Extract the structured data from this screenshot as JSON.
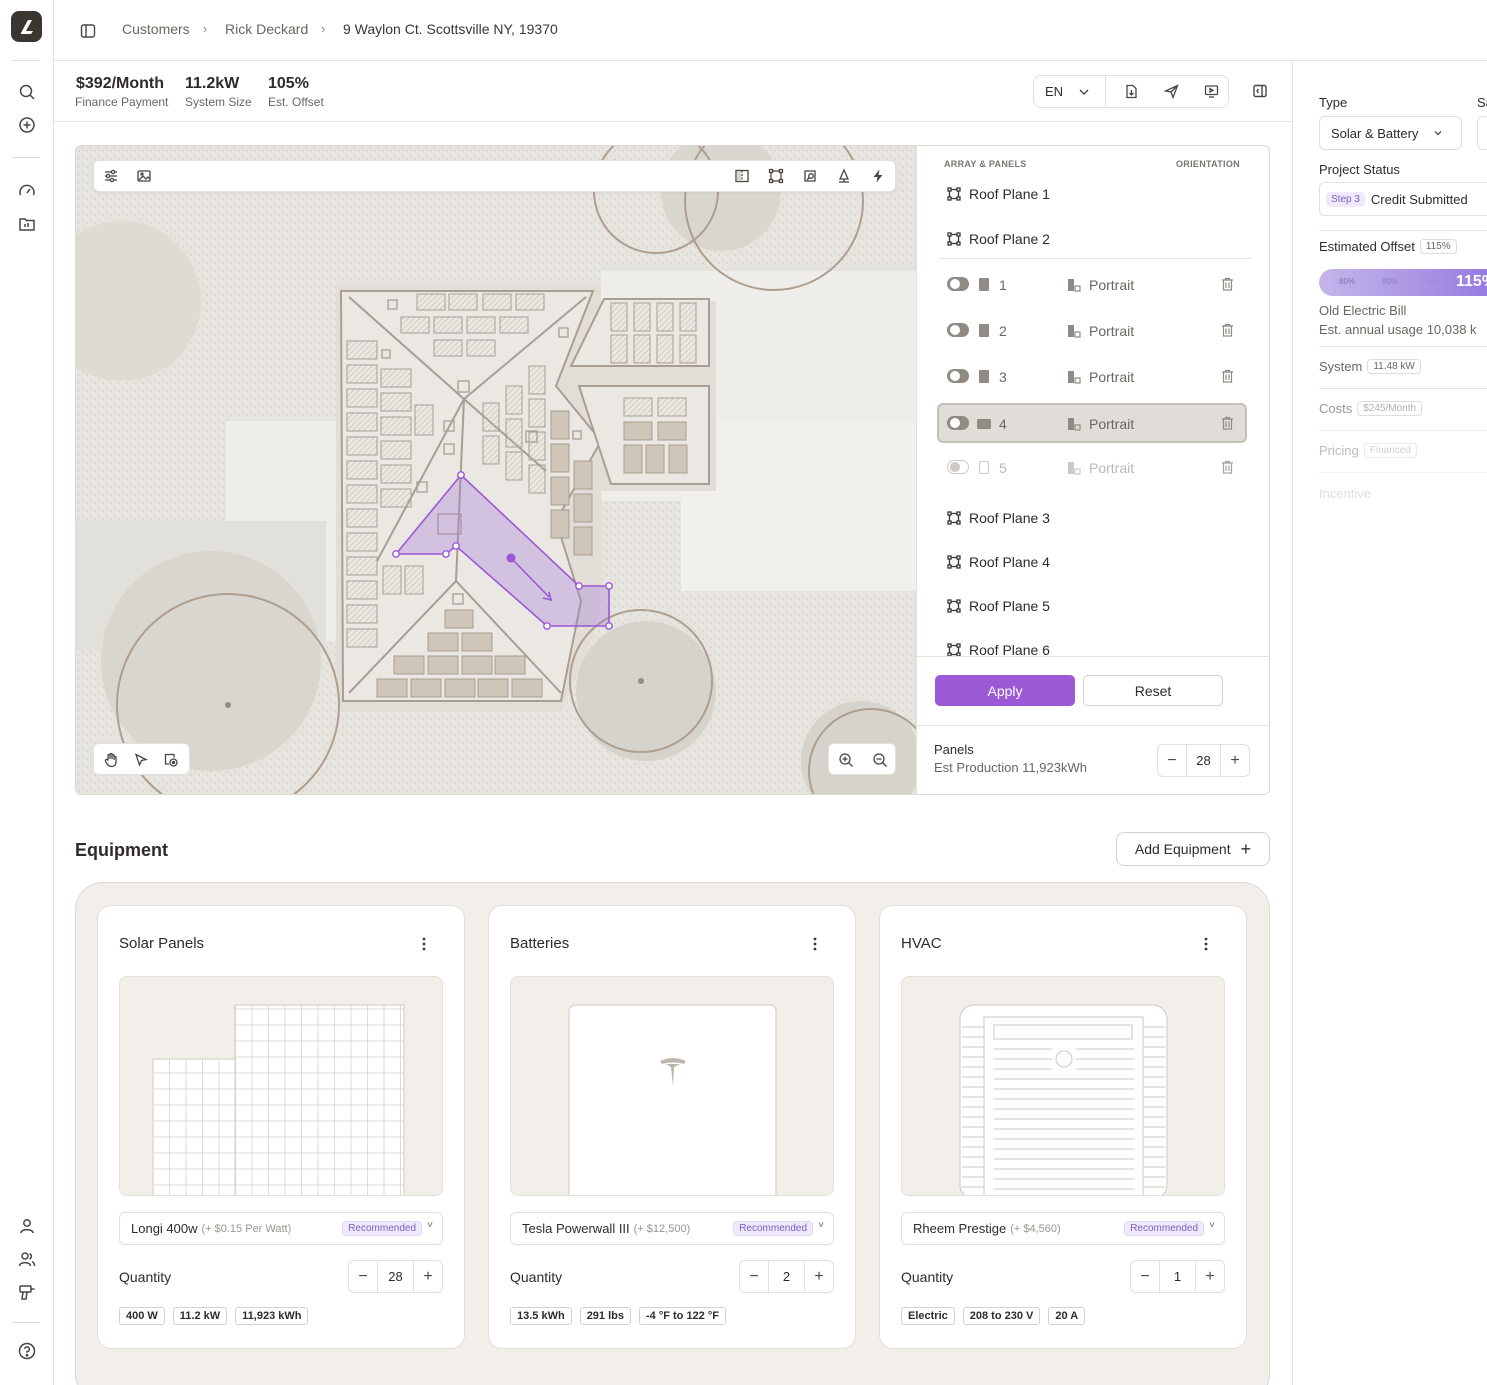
{
  "breadcrumbs": [
    "Customers",
    "Rick Deckard",
    "9 Waylon Ct. Scottsville NY, 19370"
  ],
  "summary": [
    {
      "value": "$392/Month",
      "label": "Finance Payment"
    },
    {
      "value": "11.2kW",
      "label": "System Size"
    },
    {
      "value": "105%",
      "label": "Est. Offset"
    }
  ],
  "language": "EN",
  "panel": {
    "header_left": "ARRAY & PANELS",
    "header_right": "ORIENTATION",
    "planes_top": [
      "Roof Plane 1",
      "Roof Plane 2"
    ],
    "arrays": [
      {
        "num": "1",
        "orientation": "Portrait"
      },
      {
        "num": "2",
        "orientation": "Portrait"
      },
      {
        "num": "3",
        "orientation": "Portrait"
      },
      {
        "num": "4",
        "orientation": "Portrait"
      },
      {
        "num": "5",
        "orientation": "Portrait"
      }
    ],
    "planes_bottom": [
      "Roof Plane 3",
      "Roof Plane 4",
      "Roof Plane 5",
      "Roof Plane 6"
    ],
    "apply": "Apply",
    "reset": "Reset",
    "panels_label": "Panels",
    "est_production": "Est Production 11,923kWh",
    "panel_count": "28"
  },
  "equipment": {
    "title": "Equipment",
    "add_button": "Add Equipment",
    "cards": [
      {
        "title": "Solar Panels",
        "product": "Longi 400w",
        "price": "(+ $0.15 Per Watt)",
        "badge": "Recommended",
        "qty_label": "Quantity",
        "qty": "28",
        "chips": [
          "400 W",
          "11.2 kW",
          "11,923 kWh"
        ]
      },
      {
        "title": "Batteries",
        "product": "Tesla Powerwall III",
        "price": "(+ $12,500)",
        "badge": "Recommended",
        "qty_label": "Quantity",
        "qty": "2",
        "chips": [
          "13.5 kWh",
          "291 lbs",
          "-4 °F to 122 °F"
        ]
      },
      {
        "title": "HVAC",
        "product": "Rheem Prestige",
        "price": "(+ $4,560)",
        "badge": "Recommended",
        "qty_label": "Quantity",
        "qty": "1",
        "chips": [
          "Electric",
          "208 to 230 V",
          "20 A"
        ]
      }
    ]
  },
  "sidebar": {
    "type_label": "Type",
    "second_label": "Sa",
    "type_value": "Solar & Battery",
    "status_label": "Project Status",
    "step": "Step 3",
    "status_value": "Credit Submitted",
    "offset_label": "Estimated Offset",
    "offset_pill": "115%",
    "offset_ticks": [
      "80%",
      "90%",
      "100"
    ],
    "offset_value": "115%",
    "old_bill": "Old Electric Bill",
    "annual_usage": "Est. annual usage 10,038 k",
    "system_label": "System",
    "system_pill": "11.48 kW",
    "costs_label": "Costs",
    "costs_pill": "$245/Month",
    "pricing_label": "Pricing",
    "pricing_pill": "Financed",
    "incentives_label": "Incentive"
  }
}
